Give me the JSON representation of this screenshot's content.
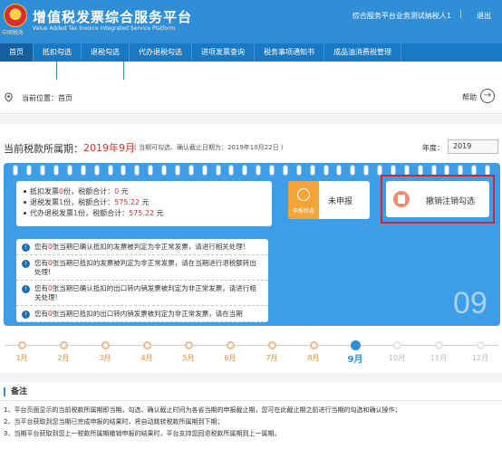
{
  "header": {
    "logo_text": "中国税务",
    "title": "增值税发票综合服务平台",
    "subtitle": "Value Added Tax Invoice Integrated Service Platform",
    "user": "综合服务平台业务测试纳税人1",
    "separator": "|",
    "logout": "退出",
    "brand_color": "#2f8ed6"
  },
  "nav": {
    "items": [
      {
        "label": "首页"
      },
      {
        "label": "抵扣勾选"
      },
      {
        "label": "退税勾选"
      },
      {
        "label": "代办退税勾选"
      },
      {
        "label": "进项发票查询"
      },
      {
        "label": "税务事项通知书"
      },
      {
        "label": "成品油消费税管理"
      }
    ]
  },
  "breadcrumb": {
    "label": "当前位置：首页",
    "help": "帮助",
    "help_icon": "→"
  },
  "period": {
    "label": "当前税款所属期：",
    "value": "2019年9月",
    "note": "( 当期可勾选、确认截止日期为：2019年10月22日 )",
    "year_label": "年度：",
    "year_value": "2019"
  },
  "stats": {
    "row1": {
      "p1": "抵扣发票",
      "count": "0",
      "p2": "份，税额合计：",
      "amount": "0",
      "unit": "元"
    },
    "row2": {
      "p1": "退税发票",
      "count": "1",
      "p2": "份，税额合计：",
      "amount": "575.22",
      "unit": "元"
    },
    "row3": {
      "p1": "代办退税发票",
      "count": "1",
      "p2": "份，税额合计：",
      "amount": "575.22",
      "unit": "元"
    }
  },
  "status_card": {
    "icon_label": "申报状态",
    "text": "未申报"
  },
  "cancel_card": {
    "text": "撤销注销勾选"
  },
  "notices": [
    {
      "pre": "您有",
      "count": "0",
      "post": "张当期已确认抵扣的发票被判定为非正常发票，请进行相关处理!"
    },
    {
      "pre": "您有",
      "count": "0",
      "post": "张当期已抵扣的发票被判定为非正常发票，请在当期进行退税额转出处理!"
    },
    {
      "pre": "您有",
      "count": "0",
      "post": "张当期已确认抵扣的出口转内销发票被判定为非正常发票，请进行相关处理!"
    },
    {
      "pre": "您有",
      "count": "0",
      "post": "张当期已抵扣的出口转内销发票被判定为非正常发票，请在当期"
    }
  ],
  "big_month": "09",
  "timeline": {
    "months": [
      "1月",
      "2月",
      "3月",
      "4月",
      "5月",
      "6月",
      "7月",
      "8月",
      "9月",
      "10月",
      "11月",
      "12月"
    ],
    "active_index": 8
  },
  "notes": {
    "title": "备注",
    "items": [
      "1、平台页面显示的当前税款所属期即当期，勾选、确认截止时间为各省当期的申报截止期，您可在此截止期之前进行当期的勾选和确认操作；",
      "2、当平台获取到您当期已完成申报的结果时，将自动跳转税款所属期到下期；",
      "3、当期平台获取到您上一税款所属期撤销申报的结果时，平台支持您回退税款所属期到上一属期。"
    ]
  }
}
